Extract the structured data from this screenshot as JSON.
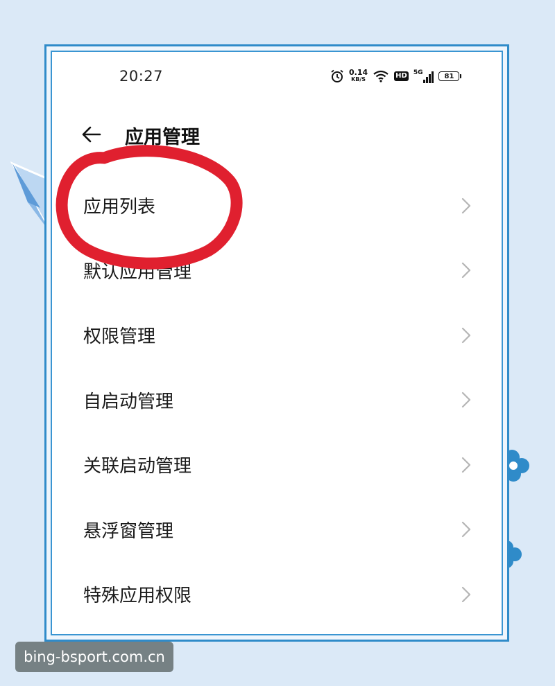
{
  "status_bar": {
    "time": "20:27",
    "net_speed_value": "0.14",
    "net_speed_unit": "KB/S",
    "hd_badge": "HD",
    "signal_type": "5G",
    "battery_level": "81",
    "icons": [
      "alarm-icon",
      "wifi-icon",
      "hd-icon",
      "signal-5g-icon",
      "battery-icon"
    ]
  },
  "header": {
    "back_icon": "arrow-left-icon",
    "title": "应用管理"
  },
  "menu": {
    "items": [
      {
        "label": "应用列表",
        "highlighted": true
      },
      {
        "label": "默认应用管理"
      },
      {
        "label": "权限管理"
      },
      {
        "label": "自启动管理"
      },
      {
        "label": "关联启动管理"
      },
      {
        "label": "悬浮窗管理"
      },
      {
        "label": "特殊应用权限"
      }
    ]
  },
  "annotation": {
    "color": "#e0202f"
  },
  "watermark": {
    "text": "bing-bsport.com.cn"
  },
  "theme": {
    "frame_color": "#2f8bc9",
    "background_color": "#dbe9f7"
  }
}
